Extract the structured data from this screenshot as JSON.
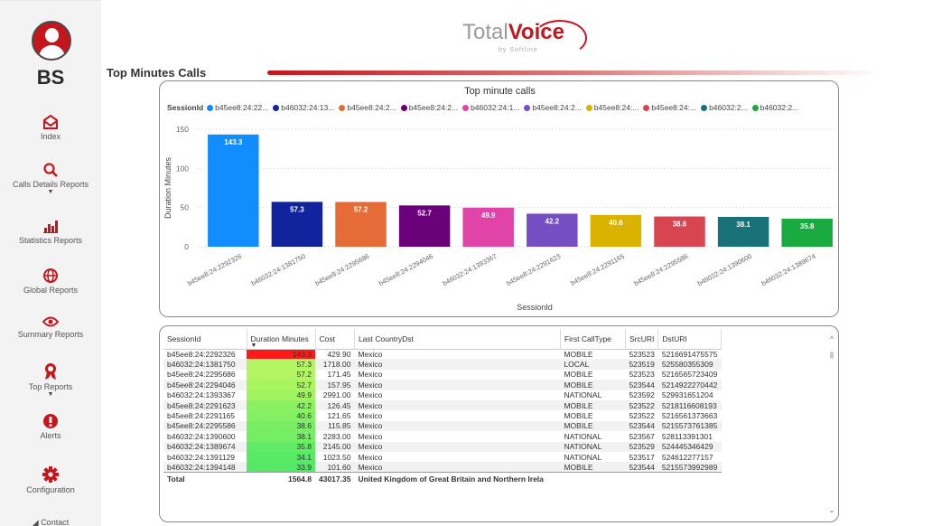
{
  "user": {
    "initials": "BS"
  },
  "nav": [
    {
      "label": "Index",
      "icon": "envelope-icon",
      "caret": false
    },
    {
      "label": "Calls Details Reports",
      "icon": "search-icon",
      "caret": true
    },
    {
      "label": "Statistics Reports",
      "icon": "bar-chart-icon",
      "caret": false
    },
    {
      "label": "Global Reports",
      "icon": "globe-icon",
      "caret": false
    },
    {
      "label": "Summary Reports",
      "icon": "eye-icon",
      "caret": false
    },
    {
      "label": "Top Reports",
      "icon": "ribbon-icon",
      "caret": true
    },
    {
      "label": "Alerts",
      "icon": "alert-icon",
      "caret": false
    },
    {
      "label": "Configuration",
      "icon": "gear-icon",
      "caret": false
    },
    {
      "label": "Contact",
      "icon": "send-icon",
      "caret": false
    }
  ],
  "logo": {
    "text_a": "Total",
    "text_b": "Voice",
    "sub": "by Softline"
  },
  "page_title": "Top Minutes Calls",
  "colors": {
    "brand": "#c4161c"
  },
  "chart_data": {
    "type": "bar",
    "title": "Top minute calls",
    "legend_title": "SessionId",
    "legend": [
      {
        "label": "b45ee8:24:22...",
        "color": "#118dff"
      },
      {
        "label": "b46032:24:13...",
        "color": "#12239e"
      },
      {
        "label": "b45ee8:24:2...",
        "color": "#e66c37"
      },
      {
        "label": "b45ee8:24:2...",
        "color": "#6b007b"
      },
      {
        "label": "b46032:24:1...",
        "color": "#e044a7"
      },
      {
        "label": "b45ee8:24:2...",
        "color": "#744ec2"
      },
      {
        "label": "b45ee8:24:...",
        "color": "#d9b300"
      },
      {
        "label": "b45ee8:24:...",
        "color": "#d64550"
      },
      {
        "label": "b46032:2...",
        "color": "#197278"
      },
      {
        "label": "b46032:2...",
        "color": "#1aab40"
      }
    ],
    "categories": [
      "b45ee8:24:2292326",
      "b46032:24:1381750",
      "b45ee8:24:2295686",
      "b45ee8:24:2294046",
      "b46032:24:1393367",
      "b45ee8:24:2291623",
      "b45ee8:24:2291165",
      "b45ee8:24:2295586",
      "b46032:24:1390600",
      "b46032:24:1389674"
    ],
    "values": [
      143.3,
      57.3,
      57.2,
      52.7,
      49.9,
      42.2,
      40.6,
      38.6,
      38.1,
      35.8
    ],
    "value_labels": [
      "143.3",
      "57.3",
      "57.2",
      "52.7",
      "49.9",
      "42.2",
      "40.6",
      "38.6",
      "38.1",
      "35.8"
    ],
    "colors": [
      "#118dff",
      "#12239e",
      "#e66c37",
      "#6b007b",
      "#e044a7",
      "#744ec2",
      "#d9b300",
      "#d64550",
      "#197278",
      "#1aab40"
    ],
    "xlabel": "SessionId",
    "ylabel": "Duration Minutes",
    "ylim": [
      0,
      150
    ],
    "yticks": [
      0,
      50,
      100,
      150
    ],
    "grid": true
  },
  "table": {
    "columns": [
      "SessionId",
      "Duration Minutes",
      "Cost",
      "Last CountryDst",
      "First CallType",
      "SrcURI",
      "DstURI"
    ],
    "rows": [
      [
        "b45ee8:24:2292326",
        "143.3",
        "429.90",
        "Mexico",
        "MOBILE",
        "523523",
        "5216691475575"
      ],
      [
        "b46032:24:1381750",
        "57.3",
        "1718.00",
        "Mexico",
        "LOCAL",
        "523519",
        "525580355309"
      ],
      [
        "b45ee8:24:2295686",
        "57.2",
        "171.45",
        "Mexico",
        "MOBILE",
        "523523",
        "5216565723409"
      ],
      [
        "b45ee8:24:2294046",
        "52.7",
        "157.95",
        "Mexico",
        "MOBILE",
        "523544",
        "5214922270442"
      ],
      [
        "b46032:24:1393367",
        "49.9",
        "2991.00",
        "Mexico",
        "NATIONAL",
        "523592",
        "529931651204"
      ],
      [
        "b45ee8:24:2291623",
        "42.2",
        "126.45",
        "Mexico",
        "MOBILE",
        "523522",
        "5218116608193"
      ],
      [
        "b45ee8:24:2291165",
        "40.6",
        "121.65",
        "Mexico",
        "MOBILE",
        "523522",
        "5216561373663"
      ],
      [
        "b45ee8:24:2295586",
        "38.6",
        "115.85",
        "Mexico",
        "MOBILE",
        "523544",
        "5215573761385"
      ],
      [
        "b46032:24:1390600",
        "38.1",
        "2283.00",
        "Mexico",
        "NATIONAL",
        "523567",
        "528113391301"
      ],
      [
        "b46032:24:1389674",
        "35.8",
        "2145.00",
        "Mexico",
        "NATIONAL",
        "523529",
        "524445346429"
      ],
      [
        "b46032:24:1391129",
        "34.1",
        "1023.50",
        "Mexico",
        "NATIONAL",
        "523517",
        "524612277157"
      ],
      [
        "b46032:24:1394148",
        "33.9",
        "101.60",
        "Mexico",
        "MOBILE",
        "523544",
        "5215573992989"
      ]
    ],
    "duration_colors": [
      "#ff1a1a",
      "#b4f564",
      "#b4f564",
      "#a8f560",
      "#a0f460",
      "#8cf162",
      "#85f063",
      "#79ee64",
      "#74ee64",
      "#62eb66",
      "#58ea67",
      "#55e967"
    ],
    "total": [
      "Total",
      "1564.8",
      "43017.35",
      "United Kingdom of Great Britain and Northern Irela"
    ]
  }
}
